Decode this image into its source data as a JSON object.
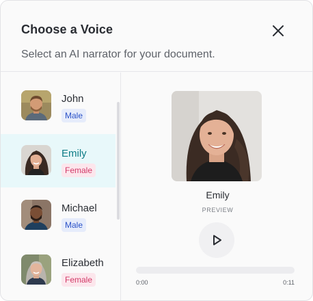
{
  "dialog": {
    "title": "Choose a Voice",
    "subtitle": "Select an AI narrator for your document.",
    "close_icon": "close-icon"
  },
  "voices": [
    {
      "name": "John",
      "gender": "Male",
      "selected": false,
      "avatar": "avatar-john"
    },
    {
      "name": "Emily",
      "gender": "Female",
      "selected": true,
      "avatar": "avatar-emily"
    },
    {
      "name": "Michael",
      "gender": "Male",
      "selected": false,
      "avatar": "avatar-michael"
    },
    {
      "name": "Elizabeth",
      "gender": "Female",
      "selected": false,
      "avatar": "avatar-elizabeth"
    }
  ],
  "preview": {
    "name": "Emily",
    "label": "PREVIEW",
    "play_icon": "play-icon",
    "progress": 0,
    "time_start": "0:00",
    "time_end": "0:11"
  },
  "colors": {
    "accent": "#0e7c86",
    "selected_bg": "#e8f8fa",
    "male_badge_bg": "#e6ecfb",
    "male_badge_text": "#2b52c8",
    "female_badge_bg": "#fce6ec",
    "female_badge_text": "#d23a68"
  }
}
